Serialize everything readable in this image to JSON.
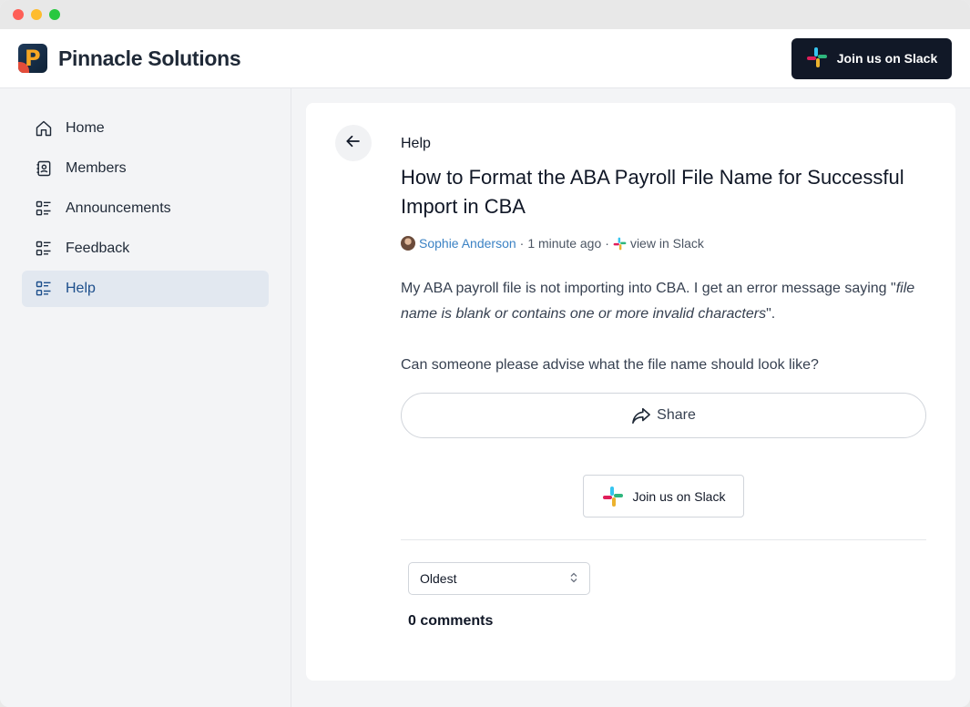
{
  "app": {
    "brand": "Pinnacle Solutions",
    "logo_letter": "P"
  },
  "header": {
    "slack_button": "Join us on Slack"
  },
  "sidebar": {
    "items": [
      {
        "label": "Home",
        "icon": "home-icon",
        "active": false
      },
      {
        "label": "Members",
        "icon": "contacts-icon",
        "active": false
      },
      {
        "label": "Announcements",
        "icon": "list-icon",
        "active": false
      },
      {
        "label": "Feedback",
        "icon": "list-icon",
        "active": false
      },
      {
        "label": "Help",
        "icon": "list-icon",
        "active": true
      }
    ]
  },
  "post": {
    "category": "Help",
    "title": "How to Format the ABA Payroll File Name for Successful Import in CBA",
    "author": "Sophie Anderson",
    "separator": "·",
    "time": "1 minute ago",
    "slack_link": "view in Slack",
    "body_part1": "My ABA payroll file is not importing into CBA. I get an error message saying \"",
    "body_italic": "file name is blank or contains one or more invalid characters",
    "body_part2": "\".",
    "body_para2": "Can someone please advise what the file name should look like?",
    "share_label": "Share",
    "slack_button": "Join us on Slack"
  },
  "comments": {
    "sort_selected": "Oldest",
    "count_label": "0 comments"
  },
  "colors": {
    "active_nav": "#1d4f8c",
    "author_link": "#3b82c4",
    "dark_button": "#111827"
  }
}
